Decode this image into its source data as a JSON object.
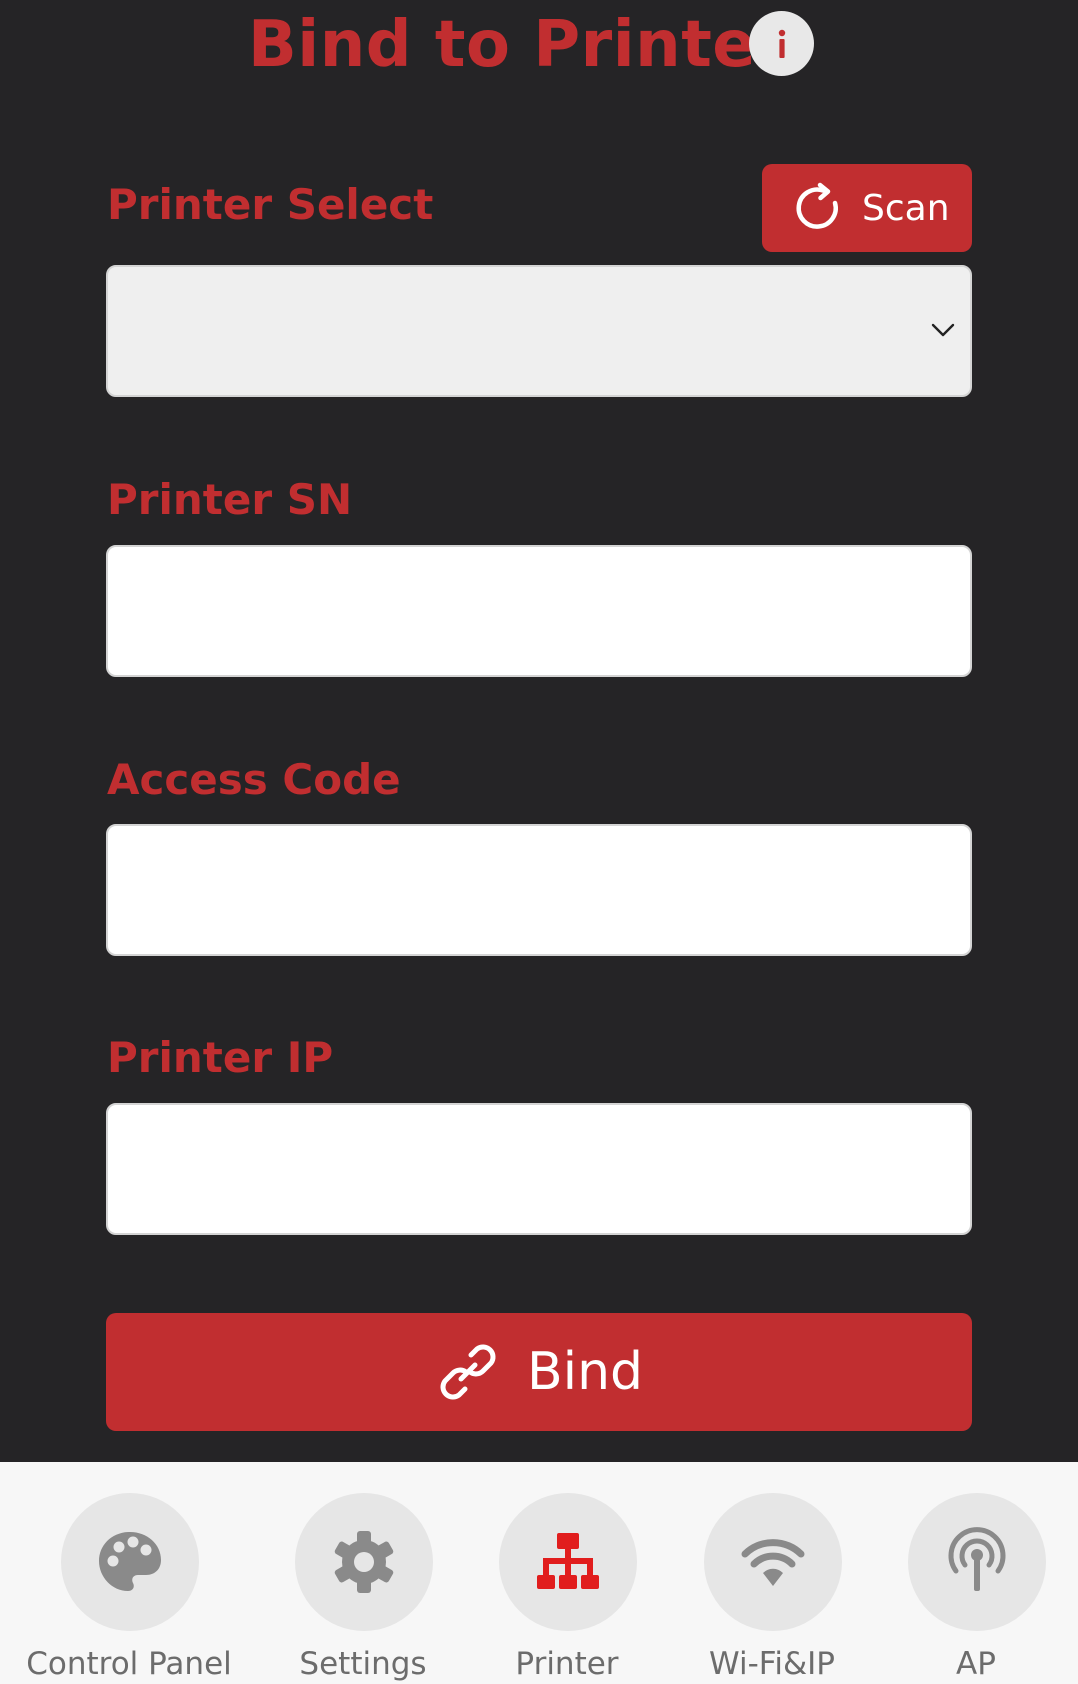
{
  "header": {
    "title": "Bind to Printer",
    "info_icon": "info-icon"
  },
  "form": {
    "printer_select": {
      "label": "Printer Select",
      "selected_value": "",
      "scan_button": {
        "label": "Scan",
        "icon": "refresh-icon"
      }
    },
    "printer_sn": {
      "label": "Printer SN",
      "value": "",
      "placeholder": ""
    },
    "access_code": {
      "label": "Access Code",
      "value": "",
      "placeholder": ""
    },
    "printer_ip": {
      "label": "Printer IP",
      "value": "",
      "placeholder": ""
    },
    "bind_button": {
      "label": "Bind",
      "icon": "link-icon"
    }
  },
  "nav": {
    "items": [
      {
        "label": "Control Panel",
        "icon": "palette-icon",
        "active": false
      },
      {
        "label": "Settings",
        "icon": "gear-icon",
        "active": false
      },
      {
        "label": "Printer",
        "icon": "network-icon",
        "active": true
      },
      {
        "label": "Wi-Fi&IP",
        "icon": "wifi-icon",
        "active": false
      },
      {
        "label": "AP",
        "icon": "antenna-icon",
        "active": false
      }
    ]
  },
  "colors": {
    "background": "#252426",
    "accent": "#c12e30",
    "nav_background": "#f7f7f7",
    "nav_circle": "#e6e6e6",
    "nav_icon": "#8a8a8a",
    "nav_icon_active": "#e11d1d"
  }
}
